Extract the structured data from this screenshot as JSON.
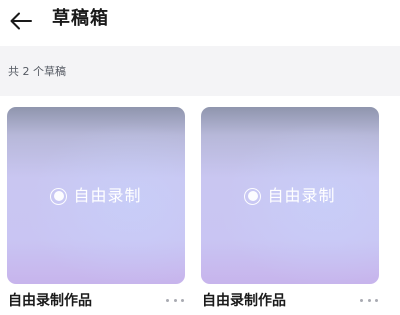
{
  "header": {
    "back_icon": "arrow-left-icon",
    "title": "草稿箱"
  },
  "drafts_count_text": "共 2 个草稿",
  "drafts": [
    {
      "thumbnail_icon": "record-icon",
      "thumbnail_label": "自由录制",
      "title": "自由录制作品",
      "more_icon": "more-dots-icon"
    },
    {
      "thumbnail_icon": "record-icon",
      "thumbnail_label": "自由录制",
      "title": "自由录制作品",
      "more_icon": "more-dots-icon"
    }
  ],
  "colors": {
    "card_gradient_top": "#8f95ad",
    "card_gradient_mid": "#c9c6f1",
    "card_gradient_bottom": "#c7b4ec",
    "count_bar_bg": "#f4f4f6",
    "text_primary": "#1a1a1a",
    "text_secondary": "#555a63"
  }
}
